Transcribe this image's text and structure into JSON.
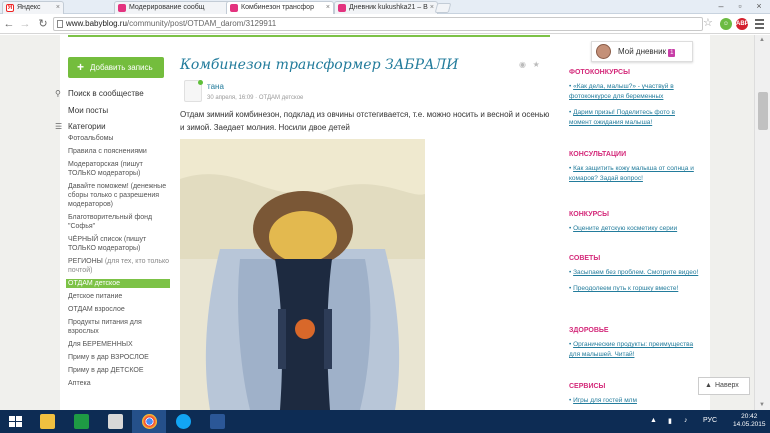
{
  "browser": {
    "tabs": [
      {
        "label": "Яндекс",
        "favicon": "yandex-icon"
      },
      {
        "label": "Модерирование сообщ",
        "favicon": "babyblog-icon"
      },
      {
        "label": "Комбинезон трансфор",
        "favicon": "babyblog-icon",
        "active": true
      },
      {
        "label": "Дневник kukushka21 – B",
        "favicon": "babyblog-icon"
      }
    ],
    "url_domain": "www.babyblog.ru",
    "url_path": "/community/post/OTDAM_darom/3129911",
    "ext_badge_1": "ABP",
    "ext_badge_2": "15"
  },
  "left_nav": {
    "add_post": "Добавить запись",
    "search": "Поиск в сообществе",
    "my_posts": "Мои посты",
    "categories": "Категории",
    "items": [
      {
        "label": "Фотоальбомы"
      },
      {
        "label": "Правила с пояснениями"
      },
      {
        "label": "Модераторская (пишут ТОЛЬКО модераторы)"
      },
      {
        "label": "Давайте поможем! (денежные сборы только с разрешения модераторов)"
      },
      {
        "label": "Благотворительный фонд \"Софья\""
      },
      {
        "label": "ЧЁРНЫЙ список (пишут ТОЛЬКО модераторы)"
      },
      {
        "label": "РЕГИОНЫ",
        "sub": "(для тех, кто только почтой)"
      },
      {
        "label": "ОТДАМ детское",
        "active": true
      },
      {
        "label": "Детское питание"
      },
      {
        "label": "ОТДАМ взрослое"
      },
      {
        "label": "Продукты питания для взрослых"
      },
      {
        "label": "Для БЕРЕМЕННЫХ"
      },
      {
        "label": "Приму в дар ВЗРОСЛОЕ"
      },
      {
        "label": "Приму в дар ДЕТСКОЕ"
      },
      {
        "label": "Аптека"
      }
    ]
  },
  "post": {
    "title": "Комбинезон трансформер ЗАБРАЛИ",
    "author": "тана",
    "date": "30 апреля, 16:09",
    "category": "ОТДАМ детское",
    "text": "Отдам зимний комбинезон, подклад из овчины отстегивается, т.е. можно носить и весной и осенью и зимой. Заедает молния. Носили двое детей"
  },
  "right_col": {
    "my_diary": "Мой дневник",
    "my_diary_count": "1",
    "sections": [
      {
        "title": "ФОТОКОНКУРСЫ",
        "items": [
          "«Как дела, малыш?» - участвуй в фотоконкурсе для беременных",
          "Дарим призы! Поделитесь фото в момент ожидания малыша!"
        ]
      },
      {
        "title": "КОНСУЛЬТАЦИИ",
        "items": [
          "Как защитить кожу малыша от солнца и комаров? Задай вопрос!"
        ]
      },
      {
        "title": "КОНКУРСЫ",
        "items": [
          "Оцените детскую косметику серии"
        ]
      },
      {
        "title": "СОВЕТЫ",
        "items": [
          "Засыпаем без проблем. Смотрите видео!",
          "Преодолеем путь к горшку вместе!"
        ]
      },
      {
        "title": "ЗДОРОВЬЕ",
        "items": [
          "Органические продукты: преимущества для малышей. Читай!"
        ]
      },
      {
        "title": "СЕРВИСЫ",
        "items": [
          "Игры для гостей млм"
        ]
      }
    ],
    "back_label": "Наверх"
  },
  "taskbar": {
    "apps": [
      "explorer-icon",
      "green-app-icon",
      "notepad-icon",
      "chrome-icon",
      "skype-icon",
      "word-icon"
    ],
    "lang": "РУС",
    "time": "20:42",
    "date": "14.05.2015"
  }
}
